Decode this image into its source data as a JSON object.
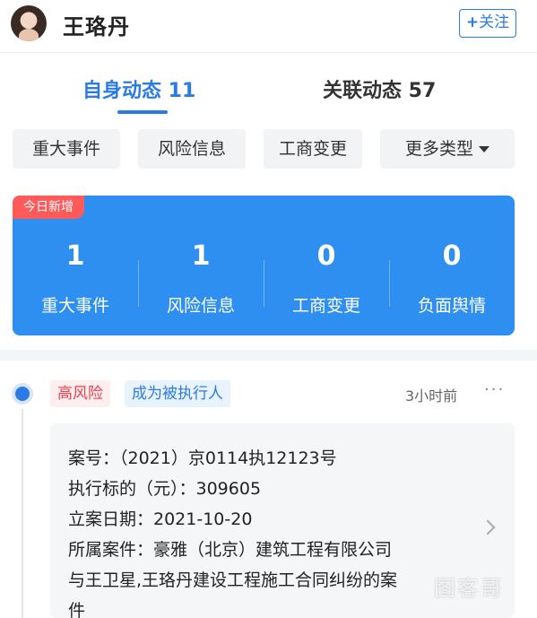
{
  "header": {
    "name": "王珞丹",
    "follow_label": "关注",
    "follow_prefix": "+"
  },
  "tabs": [
    {
      "label": "自身动态 11",
      "active": true
    },
    {
      "label": "关联动态 57",
      "active": false
    }
  ],
  "filters": [
    "重大事件",
    "风险信息",
    "工商变更",
    "更多类型"
  ],
  "stats": {
    "badge": "今日新增",
    "items": [
      {
        "value": "1",
        "label": "重大事件"
      },
      {
        "value": "1",
        "label": "风险信息"
      },
      {
        "value": "0",
        "label": "工商变更"
      },
      {
        "value": "0",
        "label": "负面舆情"
      }
    ]
  },
  "event": {
    "tags": [
      "高风险",
      "成为被执行人"
    ],
    "time": "3小时前",
    "more": "···",
    "lines": [
      "案号：（2021）京0114执12123号",
      "执行标的（元）：309605",
      "立案日期：2021-10-20",
      "所属案件：豪雅（北京）建筑工程有限公司",
      "与王卫星,王珞丹建设工程施工合同纠纷的案",
      "件"
    ]
  },
  "watermark": "图客哥"
}
